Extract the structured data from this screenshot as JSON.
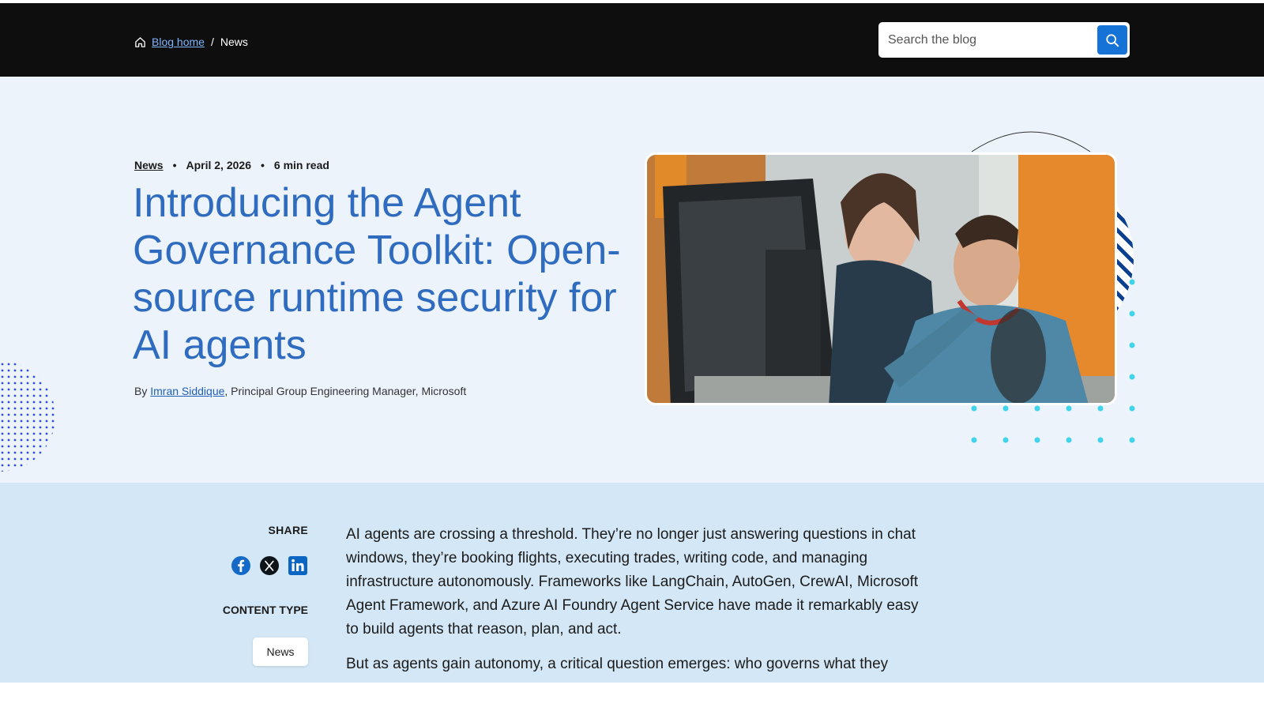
{
  "breadcrumb": {
    "home": "Blog home",
    "separator": "/",
    "current": "News"
  },
  "search": {
    "placeholder": "Search the blog"
  },
  "meta": {
    "category": "News",
    "date": "April 2, 2026",
    "read_time": "6 min read",
    "dot": "•"
  },
  "headline": "Introducing the Agent Governance Toolkit: Open-source runtime security for AI agents",
  "byline": {
    "prefix": "By ",
    "author": "Imran Siddique",
    "role": ", Principal Group Engineering Manager, Microsoft"
  },
  "sidebar": {
    "share_label": "SHARE",
    "content_type_label": "CONTENT TYPE",
    "content_type_tag": "News"
  },
  "body": {
    "p1": "AI agents are crossing a threshold. They’re no longer just answering questions in chat windows, they’re booking flights, executing trades, writing code, and managing infrastructure autonomously. Frameworks like LangChain, AutoGen, CrewAI, Microsoft Agent Framework, and Azure AI Foundry Agent Service have made it remarkably easy to build agents that reason, plan, and act.",
    "p2": "But as agents gain autonomy, a critical question emerges: who governs what they"
  },
  "colors": {
    "accent": "#2f6cbf",
    "search_button": "#1572d6",
    "hero_bg": "#edf3fb",
    "body_bg": "#d4e7f6",
    "topbar": "#0e0e0e"
  }
}
